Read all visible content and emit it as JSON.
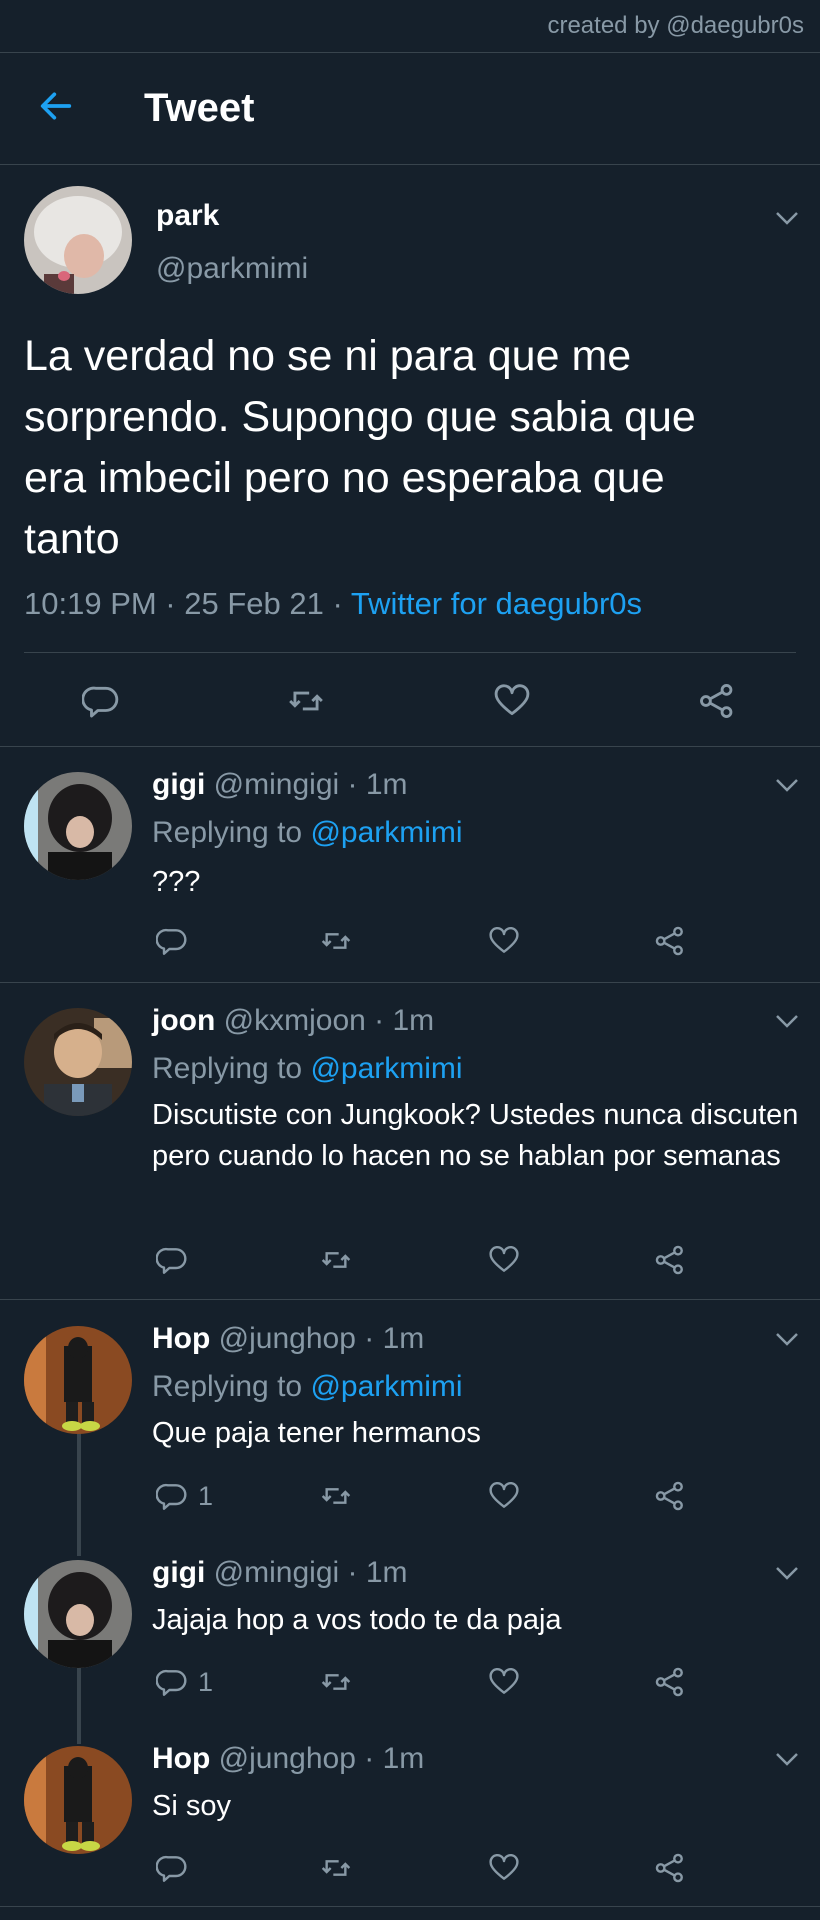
{
  "credit": "created by @daegubr0s",
  "header": {
    "title": "Tweet",
    "back_icon": "arrow-left-icon",
    "accent": "#1da1f2"
  },
  "main_tweet": {
    "name": "park",
    "handle": "@parkmimi",
    "text": "La verdad no se ni para que me\nsorprendo. Supongo que sabia que\nera imbecil pero no esperaba que\ntanto",
    "time": "10:19 PM · 25 Feb 21 · ",
    "source": "Twitter for daegubr0s",
    "actions": [
      "reply-icon",
      "retweet-icon",
      "like-icon",
      "share-icon"
    ]
  },
  "replies": [
    {
      "name": "gigi",
      "handle": "@mingigi",
      "time": " · 1m",
      "replying_label": "Replying to ",
      "replying_to": "@parkmimi",
      "text": "???",
      "reply_count": ""
    },
    {
      "name": "joon",
      "handle": "@kxmjoon",
      "time": " · 1m",
      "replying_label": "Replying to ",
      "replying_to": "@parkmimi",
      "text": "Discutiste con Jungkook? Ustedes nunca discuten pero cuando lo hacen no se hablan por semanas",
      "reply_count": ""
    },
    {
      "name": "Hop",
      "handle": "@junghop",
      "time": " · 1m",
      "replying_label": "Replying to ",
      "replying_to": "@parkmimi",
      "text": "Que paja tener hermanos",
      "reply_count": "1"
    },
    {
      "name": "gigi",
      "handle": "@mingigi",
      "time": " · 1m",
      "text": "Jajaja hop a vos todo te da paja",
      "reply_count": "1"
    },
    {
      "name": "Hop",
      "handle": "@junghop",
      "time": " · 1m",
      "text": "Si soy",
      "reply_count": ""
    }
  ],
  "colors": {
    "background": "#15202b",
    "muted": "#8899a6",
    "divider": "#38444d",
    "link": "#1da1f2"
  }
}
